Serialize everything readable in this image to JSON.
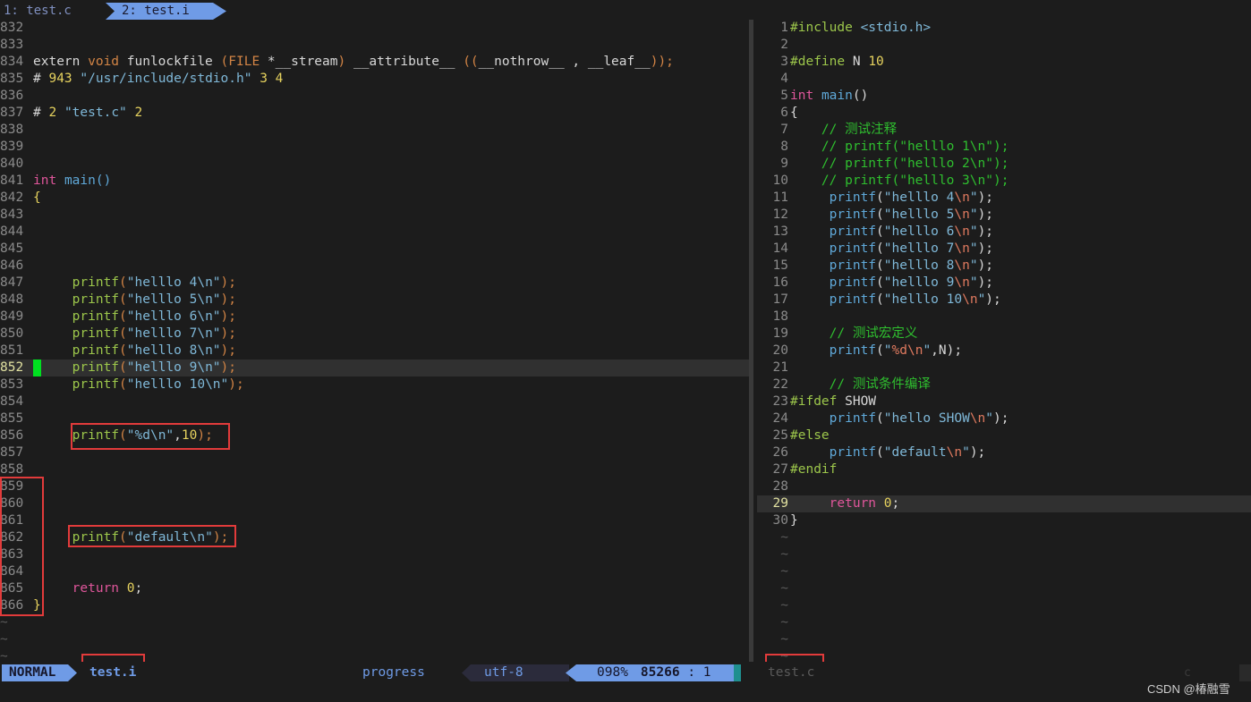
{
  "tabs": [
    {
      "label": "1: test.c"
    },
    {
      "label": "2: test.i"
    }
  ],
  "left_pane": {
    "lines": [
      {
        "n": "832",
        "tokens": []
      },
      {
        "n": "833",
        "tokens": []
      },
      {
        "n": "834",
        "tokens": [
          [
            "plain",
            "extern "
          ],
          [
            "type",
            "void"
          ],
          [
            "plain",
            " funlockfile "
          ],
          [
            "paren",
            "("
          ],
          [
            "type",
            "FILE"
          ],
          [
            "plain",
            " *__stream"
          ],
          [
            "paren",
            ")"
          ],
          [
            "plain",
            " __attribute__ "
          ],
          [
            "paren",
            "(("
          ],
          [
            "plain",
            "__nothrow__ , __leaf__"
          ],
          [
            "paren",
            "));"
          ]
        ]
      },
      {
        "n": "835",
        "tokens": [
          [
            "plain",
            "# "
          ],
          [
            "num",
            "943"
          ],
          [
            "plain",
            " "
          ],
          [
            "str",
            "\"/usr/include/stdio.h\""
          ],
          [
            "plain",
            " "
          ],
          [
            "num",
            "3 4"
          ]
        ]
      },
      {
        "n": "836",
        "tokens": []
      },
      {
        "n": "837",
        "tokens": [
          [
            "plain",
            "# "
          ],
          [
            "num",
            "2"
          ],
          [
            "plain",
            " "
          ],
          [
            "str",
            "\"test.c\""
          ],
          [
            "plain",
            " "
          ],
          [
            "num",
            "2"
          ]
        ]
      },
      {
        "n": "838",
        "tokens": []
      },
      {
        "n": "839",
        "tokens": []
      },
      {
        "n": "840",
        "tokens": []
      },
      {
        "n": "841",
        "tokens": [
          [
            "kw",
            "int"
          ],
          [
            "plain",
            " "
          ],
          [
            "fnr",
            "main()"
          ]
        ]
      },
      {
        "n": "842",
        "tokens": [
          [
            "num",
            "{"
          ]
        ]
      },
      {
        "n": "843",
        "tokens": []
      },
      {
        "n": "844",
        "tokens": []
      },
      {
        "n": "845",
        "tokens": []
      },
      {
        "n": "846",
        "tokens": []
      },
      {
        "n": "847",
        "tokens": [
          [
            "plain",
            "     "
          ],
          [
            "fn",
            "printf"
          ],
          [
            "paren",
            "("
          ],
          [
            "str",
            "\"helllo 4\\n\""
          ],
          [
            "paren",
            ");"
          ]
        ]
      },
      {
        "n": "848",
        "tokens": [
          [
            "plain",
            "     "
          ],
          [
            "fn",
            "printf"
          ],
          [
            "paren",
            "("
          ],
          [
            "str",
            "\"helllo 5\\n\""
          ],
          [
            "paren",
            ");"
          ]
        ]
      },
      {
        "n": "849",
        "tokens": [
          [
            "plain",
            "     "
          ],
          [
            "fn",
            "printf"
          ],
          [
            "paren",
            "("
          ],
          [
            "str",
            "\"helllo 6\\n\""
          ],
          [
            "paren",
            ");"
          ]
        ]
      },
      {
        "n": "850",
        "tokens": [
          [
            "plain",
            "     "
          ],
          [
            "fn",
            "printf"
          ],
          [
            "paren",
            "("
          ],
          [
            "str",
            "\"helllo 7\\n\""
          ],
          [
            "paren",
            ");"
          ]
        ]
      },
      {
        "n": "851",
        "tokens": [
          [
            "plain",
            "     "
          ],
          [
            "fn",
            "printf"
          ],
          [
            "paren",
            "("
          ],
          [
            "str",
            "\"helllo 8\\n\""
          ],
          [
            "paren",
            ");"
          ]
        ]
      },
      {
        "n": "852",
        "tokens": [
          [
            "plain",
            "     "
          ],
          [
            "fn",
            "printf"
          ],
          [
            "paren",
            "("
          ],
          [
            "str",
            "\"helllo 9\\n\""
          ],
          [
            "paren",
            ");"
          ]
        ],
        "current": true
      },
      {
        "n": "853",
        "tokens": [
          [
            "plain",
            "     "
          ],
          [
            "fn",
            "printf"
          ],
          [
            "paren",
            "("
          ],
          [
            "str",
            "\"helllo 10\\n\""
          ],
          [
            "paren",
            ");"
          ]
        ]
      },
      {
        "n": "854",
        "tokens": []
      },
      {
        "n": "855",
        "tokens": []
      },
      {
        "n": "856",
        "tokens": [
          [
            "plain",
            "     "
          ],
          [
            "fn",
            "printf"
          ],
          [
            "paren",
            "("
          ],
          [
            "str",
            "\"%d\\n\""
          ],
          [
            "plain",
            ","
          ],
          [
            "num",
            "10"
          ],
          [
            "paren",
            ");"
          ]
        ]
      },
      {
        "n": "857",
        "tokens": []
      },
      {
        "n": "858",
        "tokens": []
      },
      {
        "n": "859",
        "tokens": []
      },
      {
        "n": "860",
        "tokens": []
      },
      {
        "n": "861",
        "tokens": []
      },
      {
        "n": "862",
        "tokens": [
          [
            "plain",
            "     "
          ],
          [
            "fn",
            "printf"
          ],
          [
            "paren",
            "("
          ],
          [
            "str",
            "\"default\\n\""
          ],
          [
            "paren",
            ");"
          ]
        ]
      },
      {
        "n": "863",
        "tokens": []
      },
      {
        "n": "864",
        "tokens": []
      },
      {
        "n": "865",
        "tokens": [
          [
            "plain",
            "     "
          ],
          [
            "kw",
            "return"
          ],
          [
            "plain",
            " "
          ],
          [
            "num",
            "0"
          ],
          [
            "plain",
            ";"
          ]
        ]
      },
      {
        "n": "866",
        "tokens": [
          [
            "num",
            "}"
          ]
        ]
      },
      {
        "n": "~",
        "tokens": []
      },
      {
        "n": "~",
        "tokens": []
      },
      {
        "n": "~",
        "tokens": []
      }
    ]
  },
  "right_pane": {
    "lines": [
      {
        "n": "1",
        "tokens": [
          [
            "pre",
            "#include"
          ],
          [
            "plain",
            " "
          ],
          [
            "inc",
            "<stdio.h>"
          ]
        ]
      },
      {
        "n": "2",
        "tokens": []
      },
      {
        "n": "3",
        "tokens": [
          [
            "pre",
            "#define"
          ],
          [
            "plain",
            " N "
          ],
          [
            "num",
            "10"
          ]
        ]
      },
      {
        "n": "4",
        "tokens": []
      },
      {
        "n": "5",
        "tokens": [
          [
            "kw",
            "int"
          ],
          [
            "plain",
            " "
          ],
          [
            "fnr",
            "main"
          ],
          [
            "plain",
            "()"
          ]
        ]
      },
      {
        "n": "6",
        "tokens": [
          [
            "plain",
            "{"
          ]
        ]
      },
      {
        "n": "7",
        "tokens": [
          [
            "plain",
            "    "
          ],
          [
            "com",
            "// 测试注释"
          ]
        ]
      },
      {
        "n": "8",
        "tokens": [
          [
            "plain",
            "    "
          ],
          [
            "com",
            "// printf(\"helllo 1\\n\");"
          ]
        ]
      },
      {
        "n": "9",
        "tokens": [
          [
            "plain",
            "    "
          ],
          [
            "com",
            "// printf(\"helllo 2\\n\");"
          ]
        ]
      },
      {
        "n": "10",
        "tokens": [
          [
            "plain",
            "    "
          ],
          [
            "com",
            "// printf(\"helllo 3\\n\");"
          ]
        ]
      },
      {
        "n": "11",
        "tokens": [
          [
            "plain",
            "     "
          ],
          [
            "fnr",
            "printf"
          ],
          [
            "plain",
            "("
          ],
          [
            "str",
            "\"helllo 4"
          ],
          [
            "esc",
            "\\n"
          ],
          [
            "str",
            "\""
          ],
          [
            "plain",
            ");"
          ]
        ]
      },
      {
        "n": "12",
        "tokens": [
          [
            "plain",
            "     "
          ],
          [
            "fnr",
            "printf"
          ],
          [
            "plain",
            "("
          ],
          [
            "str",
            "\"helllo 5"
          ],
          [
            "esc",
            "\\n"
          ],
          [
            "str",
            "\""
          ],
          [
            "plain",
            ");"
          ]
        ]
      },
      {
        "n": "13",
        "tokens": [
          [
            "plain",
            "     "
          ],
          [
            "fnr",
            "printf"
          ],
          [
            "plain",
            "("
          ],
          [
            "str",
            "\"helllo 6"
          ],
          [
            "esc",
            "\\n"
          ],
          [
            "str",
            "\""
          ],
          [
            "plain",
            ");"
          ]
        ]
      },
      {
        "n": "14",
        "tokens": [
          [
            "plain",
            "     "
          ],
          [
            "fnr",
            "printf"
          ],
          [
            "plain",
            "("
          ],
          [
            "str",
            "\"helllo 7"
          ],
          [
            "esc",
            "\\n"
          ],
          [
            "str",
            "\""
          ],
          [
            "plain",
            ");"
          ]
        ]
      },
      {
        "n": "15",
        "tokens": [
          [
            "plain",
            "     "
          ],
          [
            "fnr",
            "printf"
          ],
          [
            "plain",
            "("
          ],
          [
            "str",
            "\"helllo 8"
          ],
          [
            "esc",
            "\\n"
          ],
          [
            "str",
            "\""
          ],
          [
            "plain",
            ");"
          ]
        ]
      },
      {
        "n": "16",
        "tokens": [
          [
            "plain",
            "     "
          ],
          [
            "fnr",
            "printf"
          ],
          [
            "plain",
            "("
          ],
          [
            "str",
            "\"helllo 9"
          ],
          [
            "esc",
            "\\n"
          ],
          [
            "str",
            "\""
          ],
          [
            "plain",
            ");"
          ]
        ]
      },
      {
        "n": "17",
        "tokens": [
          [
            "plain",
            "     "
          ],
          [
            "fnr",
            "printf"
          ],
          [
            "plain",
            "("
          ],
          [
            "str",
            "\"helllo 10"
          ],
          [
            "esc",
            "\\n"
          ],
          [
            "str",
            "\""
          ],
          [
            "plain",
            ");"
          ]
        ]
      },
      {
        "n": "18",
        "tokens": []
      },
      {
        "n": "19",
        "tokens": [
          [
            "plain",
            "     "
          ],
          [
            "com",
            "// 测试宏定义"
          ]
        ]
      },
      {
        "n": "20",
        "tokens": [
          [
            "plain",
            "     "
          ],
          [
            "fnr",
            "printf"
          ],
          [
            "plain",
            "("
          ],
          [
            "str",
            "\""
          ],
          [
            "esc",
            "%d\\n"
          ],
          [
            "str",
            "\""
          ],
          [
            "plain",
            ",N);"
          ]
        ]
      },
      {
        "n": "21",
        "tokens": []
      },
      {
        "n": "22",
        "tokens": [
          [
            "plain",
            "     "
          ],
          [
            "com",
            "// 测试条件编译"
          ]
        ]
      },
      {
        "n": "23",
        "tokens": [
          [
            "pre",
            "#ifdef"
          ],
          [
            "plain",
            " SHOW"
          ]
        ]
      },
      {
        "n": "24",
        "tokens": [
          [
            "plain",
            "     "
          ],
          [
            "fnr",
            "printf"
          ],
          [
            "plain",
            "("
          ],
          [
            "str",
            "\"hello SHOW"
          ],
          [
            "esc",
            "\\n"
          ],
          [
            "str",
            "\""
          ],
          [
            "plain",
            ");"
          ]
        ]
      },
      {
        "n": "25",
        "tokens": [
          [
            "pre",
            "#else"
          ]
        ]
      },
      {
        "n": "26",
        "tokens": [
          [
            "plain",
            "     "
          ],
          [
            "fnr",
            "printf"
          ],
          [
            "plain",
            "("
          ],
          [
            "str",
            "\"default"
          ],
          [
            "esc",
            "\\n"
          ],
          [
            "str",
            "\""
          ],
          [
            "plain",
            ");"
          ]
        ]
      },
      {
        "n": "27",
        "tokens": [
          [
            "pre",
            "#endif"
          ]
        ]
      },
      {
        "n": "28",
        "tokens": []
      },
      {
        "n": "29",
        "tokens": [
          [
            "plain",
            "     "
          ],
          [
            "kw",
            "return"
          ],
          [
            "plain",
            " "
          ],
          [
            "num",
            "0"
          ],
          [
            "plain",
            ";"
          ]
        ],
        "current": true
      },
      {
        "n": "30",
        "tokens": [
          [
            "plain",
            "}"
          ]
        ]
      },
      {
        "n": "~",
        "tokens": []
      },
      {
        "n": "~",
        "tokens": []
      },
      {
        "n": "~",
        "tokens": []
      },
      {
        "n": "~",
        "tokens": []
      },
      {
        "n": "~",
        "tokens": []
      },
      {
        "n": "~",
        "tokens": []
      },
      {
        "n": "~",
        "tokens": []
      },
      {
        "n": "~",
        "tokens": []
      }
    ]
  },
  "status": {
    "mode": "NORMAL",
    "filename": "test.i",
    "progress": "progress",
    "encoding": "utf-8",
    "percent": "098%",
    "line": "85266",
    "col_sep": ":",
    "col": "1",
    "right_filename": "test.c",
    "right_filetype": "c"
  },
  "watermark": "CSDN @椿融雪"
}
